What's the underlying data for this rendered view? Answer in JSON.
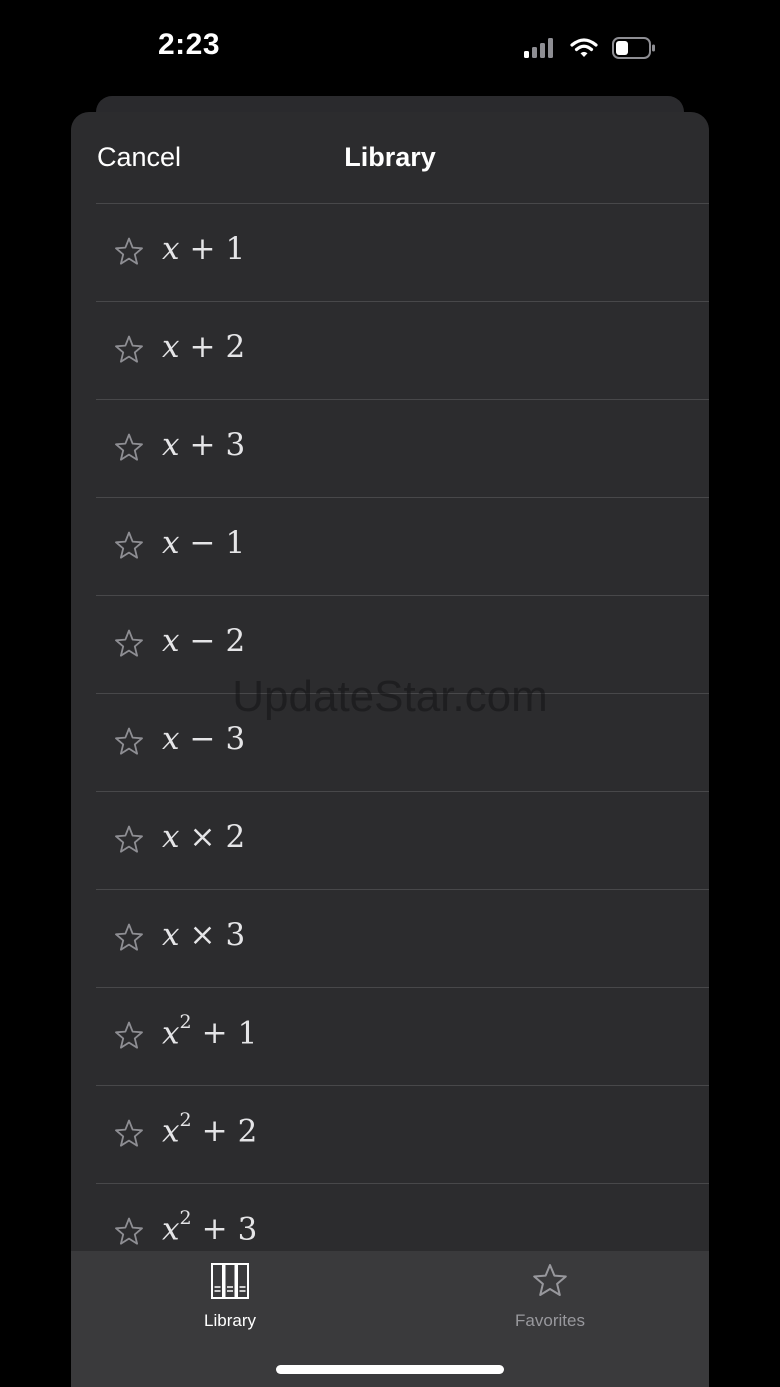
{
  "status_bar": {
    "time": "2:23",
    "icons": [
      "cellular-signal-icon",
      "wifi-icon",
      "battery-icon"
    ]
  },
  "nav": {
    "cancel_label": "Cancel",
    "title": "Library"
  },
  "items": [
    {
      "var": "x",
      "power": "",
      "op": "+",
      "num": "1"
    },
    {
      "var": "x",
      "power": "",
      "op": "+",
      "num": "2"
    },
    {
      "var": "x",
      "power": "",
      "op": "+",
      "num": "3"
    },
    {
      "var": "x",
      "power": "",
      "op": "−",
      "num": "1"
    },
    {
      "var": "x",
      "power": "",
      "op": "−",
      "num": "2"
    },
    {
      "var": "x",
      "power": "",
      "op": "−",
      "num": "3"
    },
    {
      "var": "x",
      "power": "",
      "op": "×",
      "num": "2"
    },
    {
      "var": "x",
      "power": "",
      "op": "×",
      "num": "3"
    },
    {
      "var": "x",
      "power": "2",
      "op": "+",
      "num": "1"
    },
    {
      "var": "x",
      "power": "2",
      "op": "+",
      "num": "2"
    },
    {
      "var": "x",
      "power": "2",
      "op": "+",
      "num": "3"
    }
  ],
  "watermark": "UpdateStar.com",
  "tabs": {
    "library": {
      "label": "Library",
      "icon": "books-icon"
    },
    "favorites": {
      "label": "Favorites",
      "icon": "star-icon"
    }
  },
  "colors": {
    "background": "#000000",
    "sheet": "#2c2c2e",
    "tab_bar": "#3a3a3c",
    "separator": "#48484a",
    "text": "#ffffff",
    "inactive_tab": "#98989d"
  }
}
